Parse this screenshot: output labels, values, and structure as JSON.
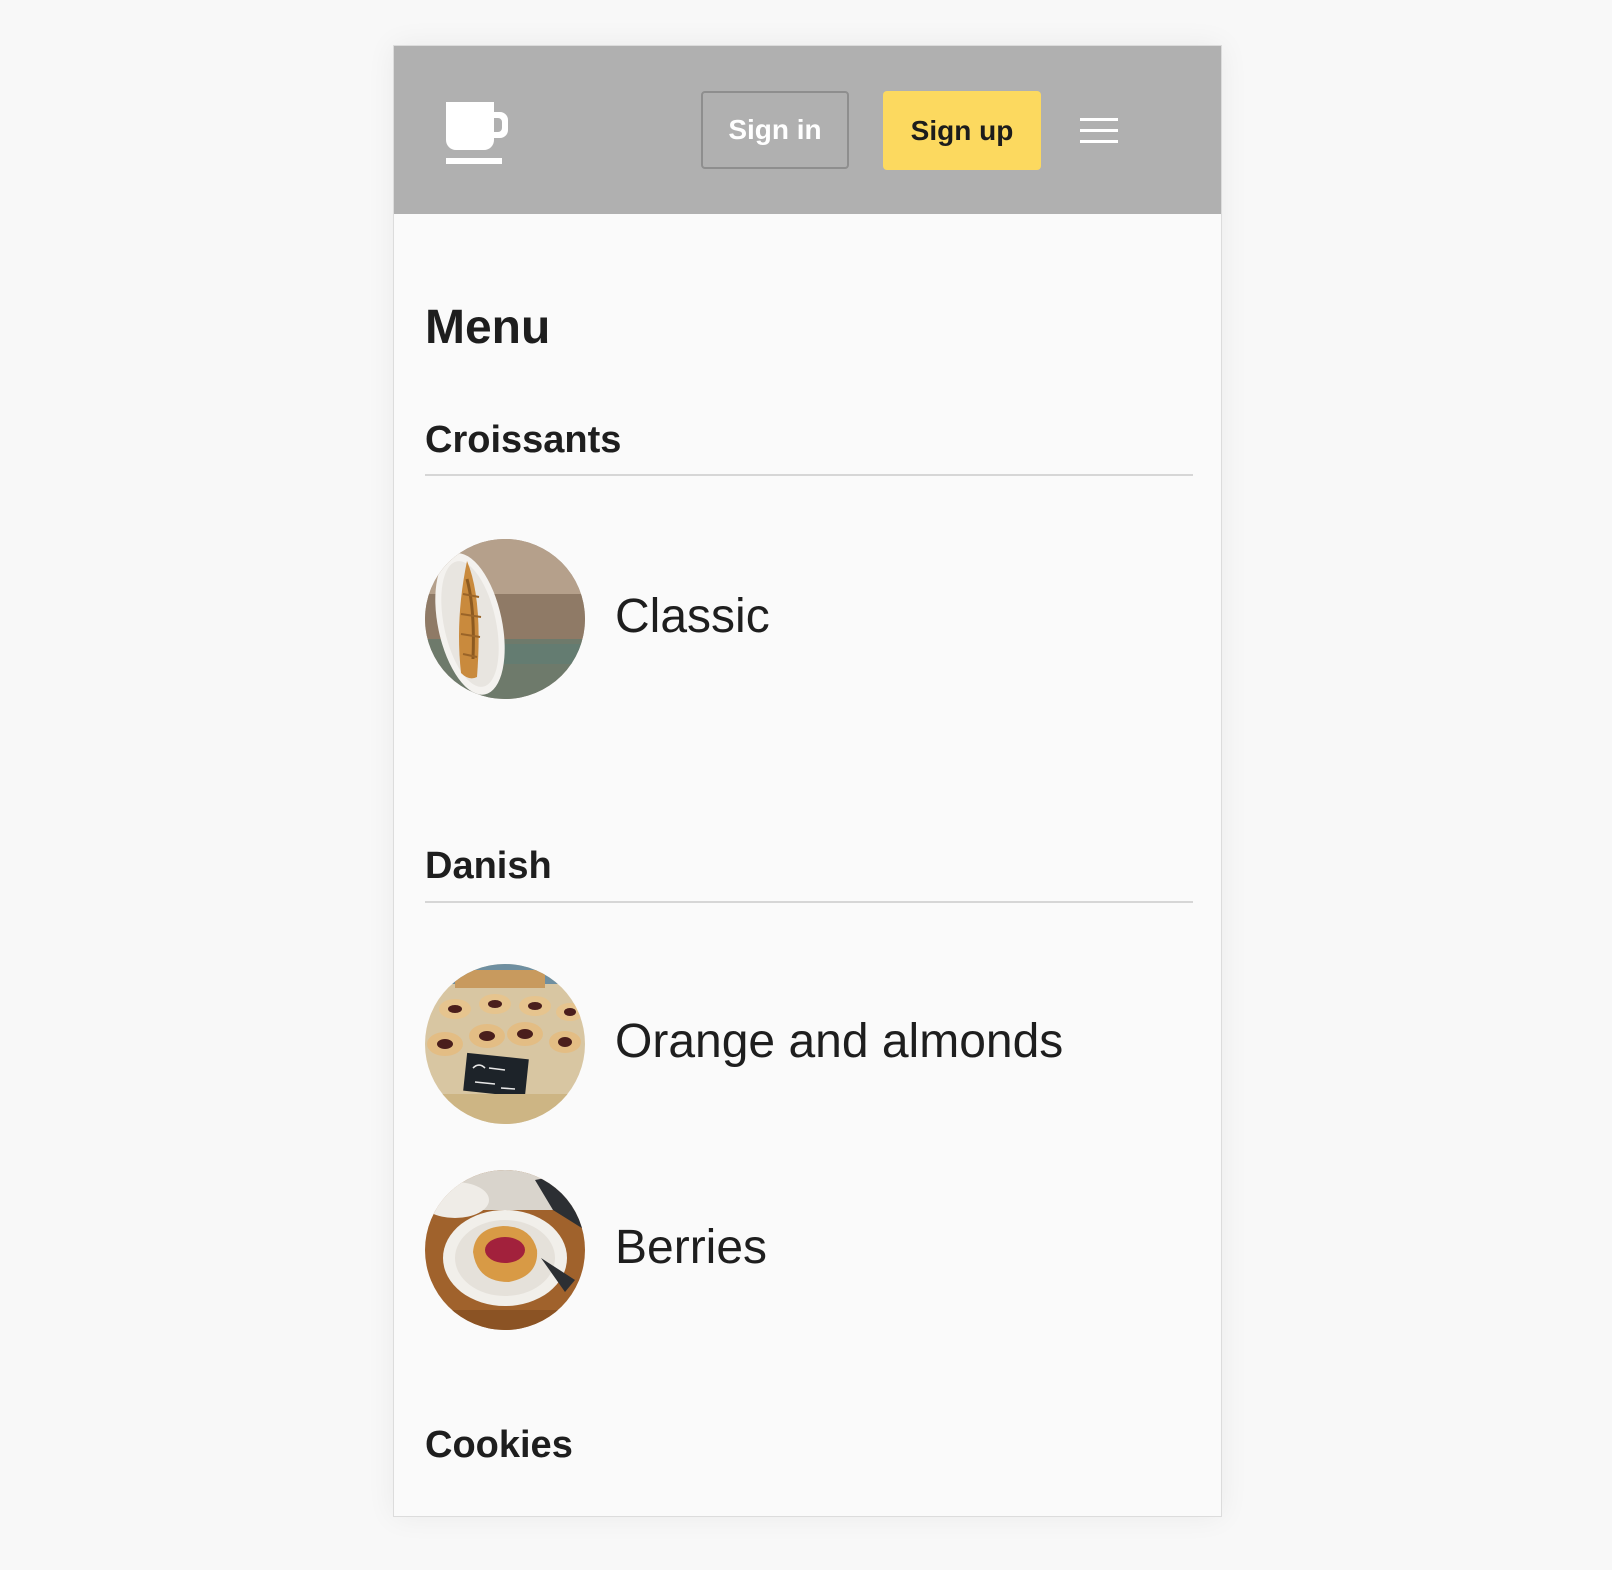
{
  "header": {
    "logo_icon": "coffee-cup-icon",
    "sign_in_label": "Sign in",
    "sign_up_label": "Sign up",
    "menu_icon": "hamburger-menu-icon",
    "colors": {
      "header_background": "#b0b0b0",
      "sign_up_background": "#fcd95f"
    }
  },
  "page": {
    "title": "Menu"
  },
  "sections": [
    {
      "title": "Croissants",
      "items": [
        {
          "name": "Classic",
          "image": "croissant-photo"
        }
      ]
    },
    {
      "title": "Danish",
      "items": [
        {
          "name": "Orange and almonds",
          "image": "danish-pastries-photo",
          "image_sign_text": "Cherry Danish $3.95"
        },
        {
          "name": "Berries",
          "image": "berry-galette-photo"
        }
      ]
    },
    {
      "title": "Cookies",
      "items": []
    }
  ]
}
